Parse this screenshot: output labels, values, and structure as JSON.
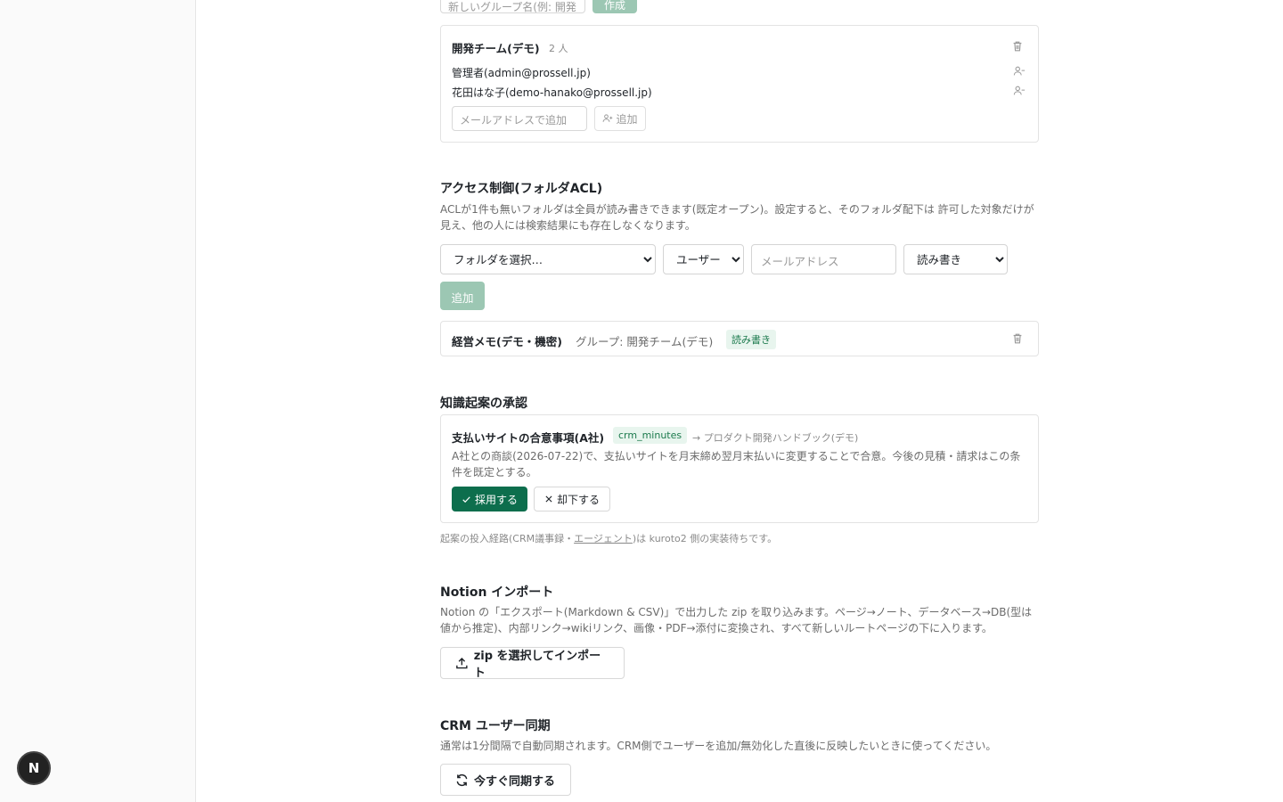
{
  "groups": {
    "new_group_placeholder": "新しいグループ名(例: 開発",
    "create_label": "作成",
    "group": {
      "name": "開発チーム(デモ)",
      "count": "2 人",
      "members": [
        "管理者(admin@prossell.jp)",
        "花田はな子(demo-hanako@prossell.jp)"
      ],
      "email_placeholder": "メールアドレスで追加",
      "add_label": "追加"
    }
  },
  "acl": {
    "title": "アクセス制御(フォルダACL)",
    "description": "ACLが1件も無いフォルダは全員が読み書きできます(既定オープン)。設定すると、そのフォルダ配下は 許可した対象だけが見え、他の人には検索結果にも存在しなくなります。",
    "folder_select": "フォルダを選択…",
    "type_select": "ユーザー",
    "email_placeholder": "メールアドレス",
    "perm_select": "読み書き",
    "add_label": "追加",
    "entry": {
      "folder": "経営メモ(デモ・機密)",
      "target": "グループ: 開発チーム(デモ)",
      "permission": "読み書き"
    }
  },
  "proposals": {
    "title": "知識起案の承認",
    "item": {
      "title": "支払いサイトの合意事項(A社)",
      "source": "crm_minutes",
      "destination": "→ プロダクト開発ハンドブック(デモ)",
      "body": "A社との商談(2026-07-22)で、支払いサイトを月末締め翌月末払いに変更することで合意。今後の見積・請求はこの条件を既定とする。",
      "accept_label": "採用する",
      "reject_label": "却下する"
    },
    "note_before": "起案の投入経路(CRM議事録・",
    "note_link": "エージェント",
    "note_after": ")は kuroto2 側の実装待ちです。"
  },
  "notion": {
    "title": "Notion インポート",
    "description": "Notion の「エクスポート(Markdown & CSV)」で出力した zip を取り込みます。ページ→ノート、データベース→DB(型は値から推定)、内部リンク→wikiリンク、画像・PDF→添付に変換され、すべて新しいルートページの下に入ります。",
    "button_label": "zip を選択してインポート"
  },
  "crm": {
    "title": "CRM ユーザー同期",
    "description": "通常は1分間隔で自動同期されます。CRM側でユーザーを追加/無効化した直後に反映したいときに使ってください。",
    "button_label": "今すぐ同期する"
  },
  "badge": {
    "letter": "N"
  },
  "colors": {
    "accent": "#0d6e4d",
    "accent_disabled": "#9cc7b3",
    "badge_bg": "#e8f5ee"
  }
}
